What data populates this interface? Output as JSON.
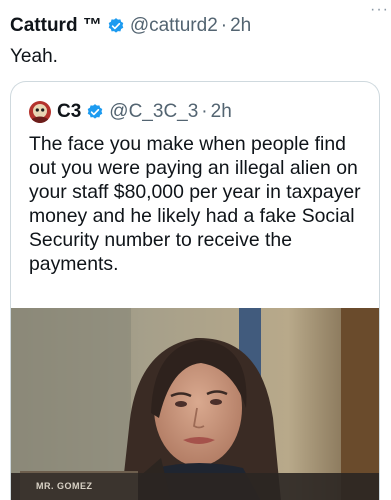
{
  "tweet": {
    "author_name": "Catturd ™",
    "handle": "@catturd2",
    "separator": "·",
    "time": "2h",
    "text": "Yeah.",
    "more_icon": "more-dots-icon",
    "verified_icon": "verified-badge-icon"
  },
  "quoted_tweet": {
    "author_name": "C3",
    "handle": "@C_3C_3",
    "separator": "·",
    "time": "2h",
    "text": "The face you make when people find out you were paying an illegal alien on your staff $80,000 per year in taxpayer money and he likely had a fake Social Security number to receive the payments.",
    "nameplate_text": "MR. GOMEZ"
  },
  "colors": {
    "verified_blue": "#1d9bf0",
    "secondary_text": "#536471",
    "border": "#cfd9de"
  }
}
